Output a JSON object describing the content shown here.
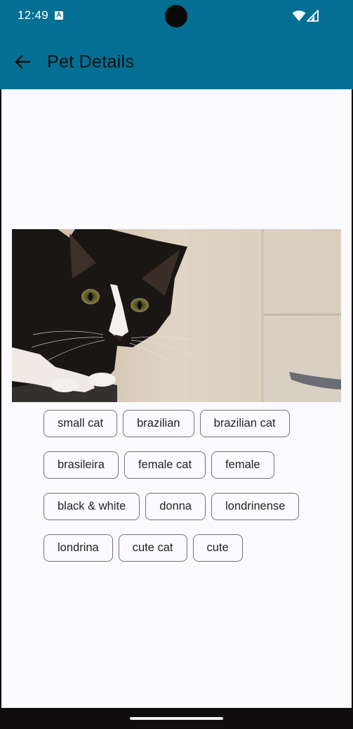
{
  "status_bar": {
    "time": "12:49",
    "notification_icon": "A",
    "icons": [
      "wifi-icon",
      "signal-icon"
    ]
  },
  "app_bar": {
    "back_icon": "arrow-left-icon",
    "title": "Pet Details",
    "background_color": "#046f92"
  },
  "pet": {
    "image": "cat-photo",
    "tags": [
      "small cat",
      "brazilian",
      "brazilian cat",
      "brasileira",
      "female cat",
      "female",
      "black & white",
      "donna",
      "londrinense",
      "londrina",
      "cute cat",
      "cute"
    ]
  }
}
